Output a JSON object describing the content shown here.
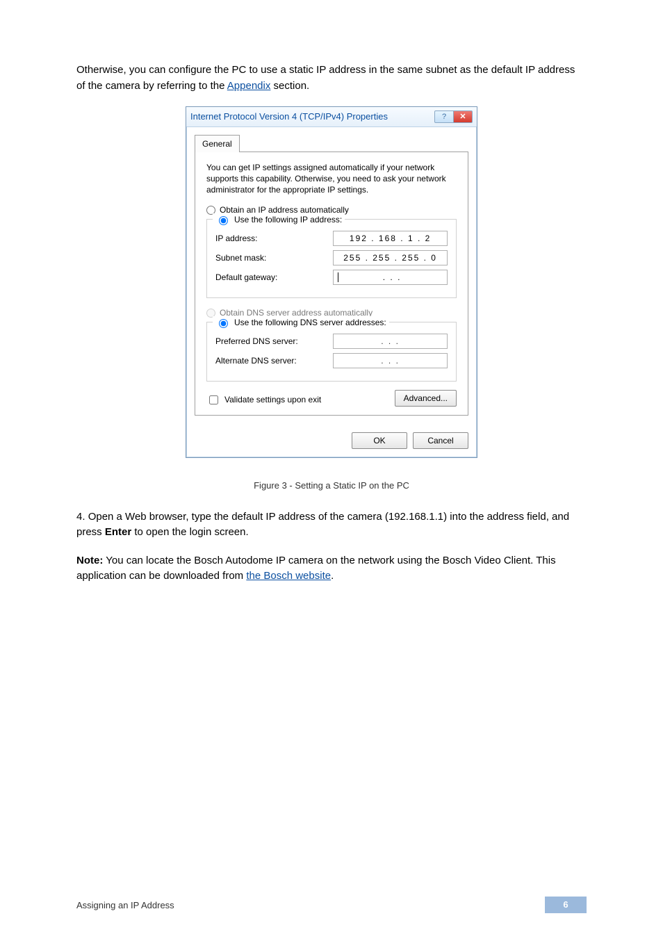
{
  "para1_before": "Otherwise, you can configure the PC to use a static IP address in the same subnet as the default IP address of the camera by referring to the ",
  "para1_link": "Appendix",
  "para1_after": " section.",
  "dialog": {
    "title": "Internet Protocol Version 4 (TCP/IPv4) Properties",
    "tab": "General",
    "desc": "You can get IP settings assigned automatically if your network supports this capability. Otherwise, you need to ask your network administrator for the appropriate IP settings.",
    "radio_obtain_ip": "Obtain an IP address automatically",
    "radio_use_ip": "Use the following IP address:",
    "ip_label": "IP address:",
    "ip_value": "192 . 168 .  1  .  2",
    "subnet_label": "Subnet mask:",
    "subnet_value": "255 . 255 . 255 .  0",
    "gateway_label": "Default gateway:",
    "gateway_value": "   .      .      .   ",
    "radio_obtain_dns": "Obtain DNS server address automatically",
    "radio_use_dns": "Use the following DNS server addresses:",
    "pref_dns_label": "Preferred DNS server:",
    "pref_dns_value": "   .      .      .   ",
    "alt_dns_label": "Alternate DNS server:",
    "alt_dns_value": "   .      .      .   ",
    "validate": "Validate settings upon exit",
    "advanced": "Advanced...",
    "ok": "OK",
    "cancel": "Cancel"
  },
  "para2_step": "4. ",
  "para2_body": "Open a Web browser, type the default IP address of the camera (192.168.1.1) into the address field, and press ",
  "para2_bold": "Enter",
  "para2_after": " to open the login screen.",
  "note_label": "Note:",
  "note_body": " You can locate the Bosch Autodome IP camera on the network using the Bosch Video Client. This application can be downloaded from ",
  "note_link": "the Bosch website",
  "note_after": ".",
  "figure_caption": "Figure 3 - Setting a Static IP on the PC",
  "footer_left": "Assigning an IP Address",
  "footer_page": "6"
}
